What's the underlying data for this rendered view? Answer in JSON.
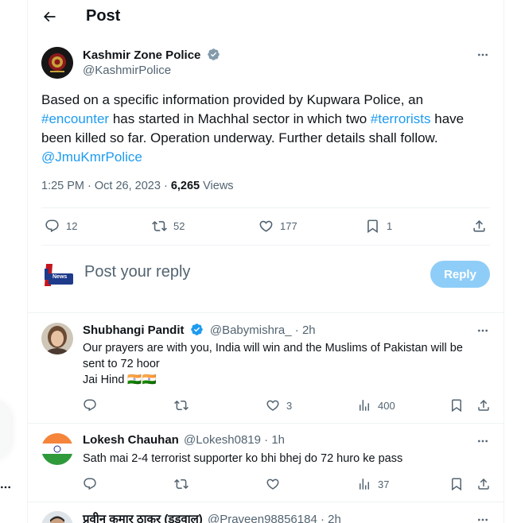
{
  "header": {
    "title": "Post"
  },
  "post": {
    "author_name": "Kashmir Zone Police",
    "author_handle": "@KashmirPolice",
    "text_1": "Based on a specific information provided by Kupwara Police, an",
    "hashtag_encounter": "#encounter",
    "text_2": "has started in Machhal sector in which two",
    "hashtag_terrorists": "#terrorists",
    "text_3": "have",
    "text_4": "been killed so far. Operation underway. Further details shall follow.",
    "mention": "@JmuKmrPolice",
    "timestamp": "1:25 PM · Oct 26, 2023 ·",
    "views_count": "6,265",
    "views_label": "Views",
    "stats": {
      "replies": "12",
      "reposts": "52",
      "likes": "177",
      "bookmarks": "1"
    }
  },
  "reply_box": {
    "placeholder": "Post your reply",
    "button_label": "Reply",
    "avatar_logo_text": "News"
  },
  "replies": [
    {
      "name": "Shubhangi Pandit",
      "handle": "@Babymishra_",
      "time": "· 2h",
      "text_line1": "Our prayers are with you, India will win and the Muslims of Pakistan will be",
      "text_line2": "sent to 72 hoor",
      "text_line3": "Jai Hind",
      "flags": "🇮🇳🇮🇳",
      "likes": "3",
      "views": "400"
    },
    {
      "name": "Lokesh Chauhan",
      "handle": "@Lokesh0819",
      "time": "· 1h",
      "text_line1": "Sath mai 2-4 terrorist supporter ko bhi bhej do 72 huro ke pass",
      "views": "37"
    },
    {
      "name": "प्रवीन कुमार ठाकुर (डडवाल)",
      "handle": "@Praveen98856184",
      "time": "· 2h"
    }
  ],
  "colors": {
    "accent": "#1d9bf0",
    "muted": "#536471",
    "text": "#0f1419",
    "divider": "#eff3f4"
  }
}
